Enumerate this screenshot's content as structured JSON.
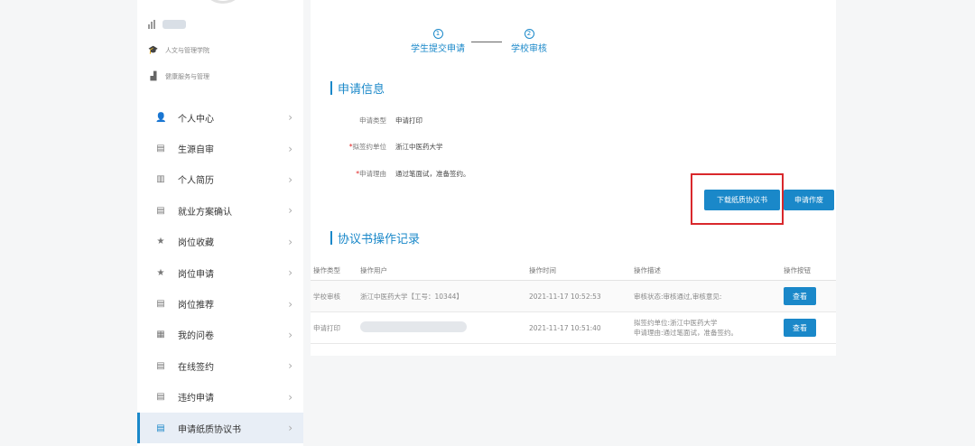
{
  "sidebar": {
    "meta": [
      {
        "icon": "graduation-cap-icon",
        "label": "人文与管理学院"
      },
      {
        "icon": "building-icon",
        "label": "健康服务与管理"
      }
    ],
    "menu": [
      {
        "icon": "person-icon",
        "label": "个人中心",
        "active": false
      },
      {
        "icon": "id-card-icon",
        "label": "生源自审",
        "active": false
      },
      {
        "icon": "document-icon",
        "label": "个人简历",
        "active": false
      },
      {
        "icon": "id-card-icon",
        "label": "就业方案确认",
        "active": false
      },
      {
        "icon": "star-icon",
        "label": "岗位收藏",
        "active": false
      },
      {
        "icon": "star-icon",
        "label": "岗位申请",
        "active": false
      },
      {
        "icon": "id-card-icon",
        "label": "岗位推荐",
        "active": false
      },
      {
        "icon": "questionnaire-icon",
        "label": "我的问卷",
        "active": false
      },
      {
        "icon": "id-card-icon",
        "label": "在线签约",
        "active": false
      },
      {
        "icon": "id-card-icon",
        "label": "违约申请",
        "active": false
      },
      {
        "icon": "id-card-icon",
        "label": "申请纸质协议书",
        "active": true
      }
    ]
  },
  "steps": [
    {
      "num": "①",
      "label": "学生提交申请"
    },
    {
      "num": "②",
      "label": "学校审核"
    }
  ],
  "apply_info": {
    "title": "申请信息",
    "rows": [
      {
        "key": "申请类型",
        "required": false,
        "value": "申请打印"
      },
      {
        "key": "拟签约单位",
        "required": true,
        "value": "浙江中医药大学"
      },
      {
        "key": "申请理由",
        "required": true,
        "value": "通过笔面试，准备签约。"
      }
    ],
    "download_label": "下载纸质协议书",
    "cancel_label": "申请作废"
  },
  "records": {
    "title": "协议书操作记录",
    "headers": [
      "操作类型",
      "操作用户",
      "操作时间",
      "操作描述",
      "操作按钮"
    ],
    "rows": [
      {
        "type": "学校审核",
        "user": "浙江中医药大学【工号：10344】",
        "time": "2021-11-17 10:52:53",
        "desc1": "审核状态:审核通过,审核意见:",
        "desc2": "",
        "button": "查看"
      },
      {
        "type": "申请打印",
        "user": "",
        "time": "2021-11-17 10:51:40",
        "desc1": "拟签约单位:浙江中医药大学",
        "desc2": "申请理由:通过笔面试，准备签约。",
        "button": "查看"
      }
    ]
  },
  "colors": {
    "accent": "#1a88c9",
    "highlight": "#d9282c",
    "required": "#e02020"
  }
}
